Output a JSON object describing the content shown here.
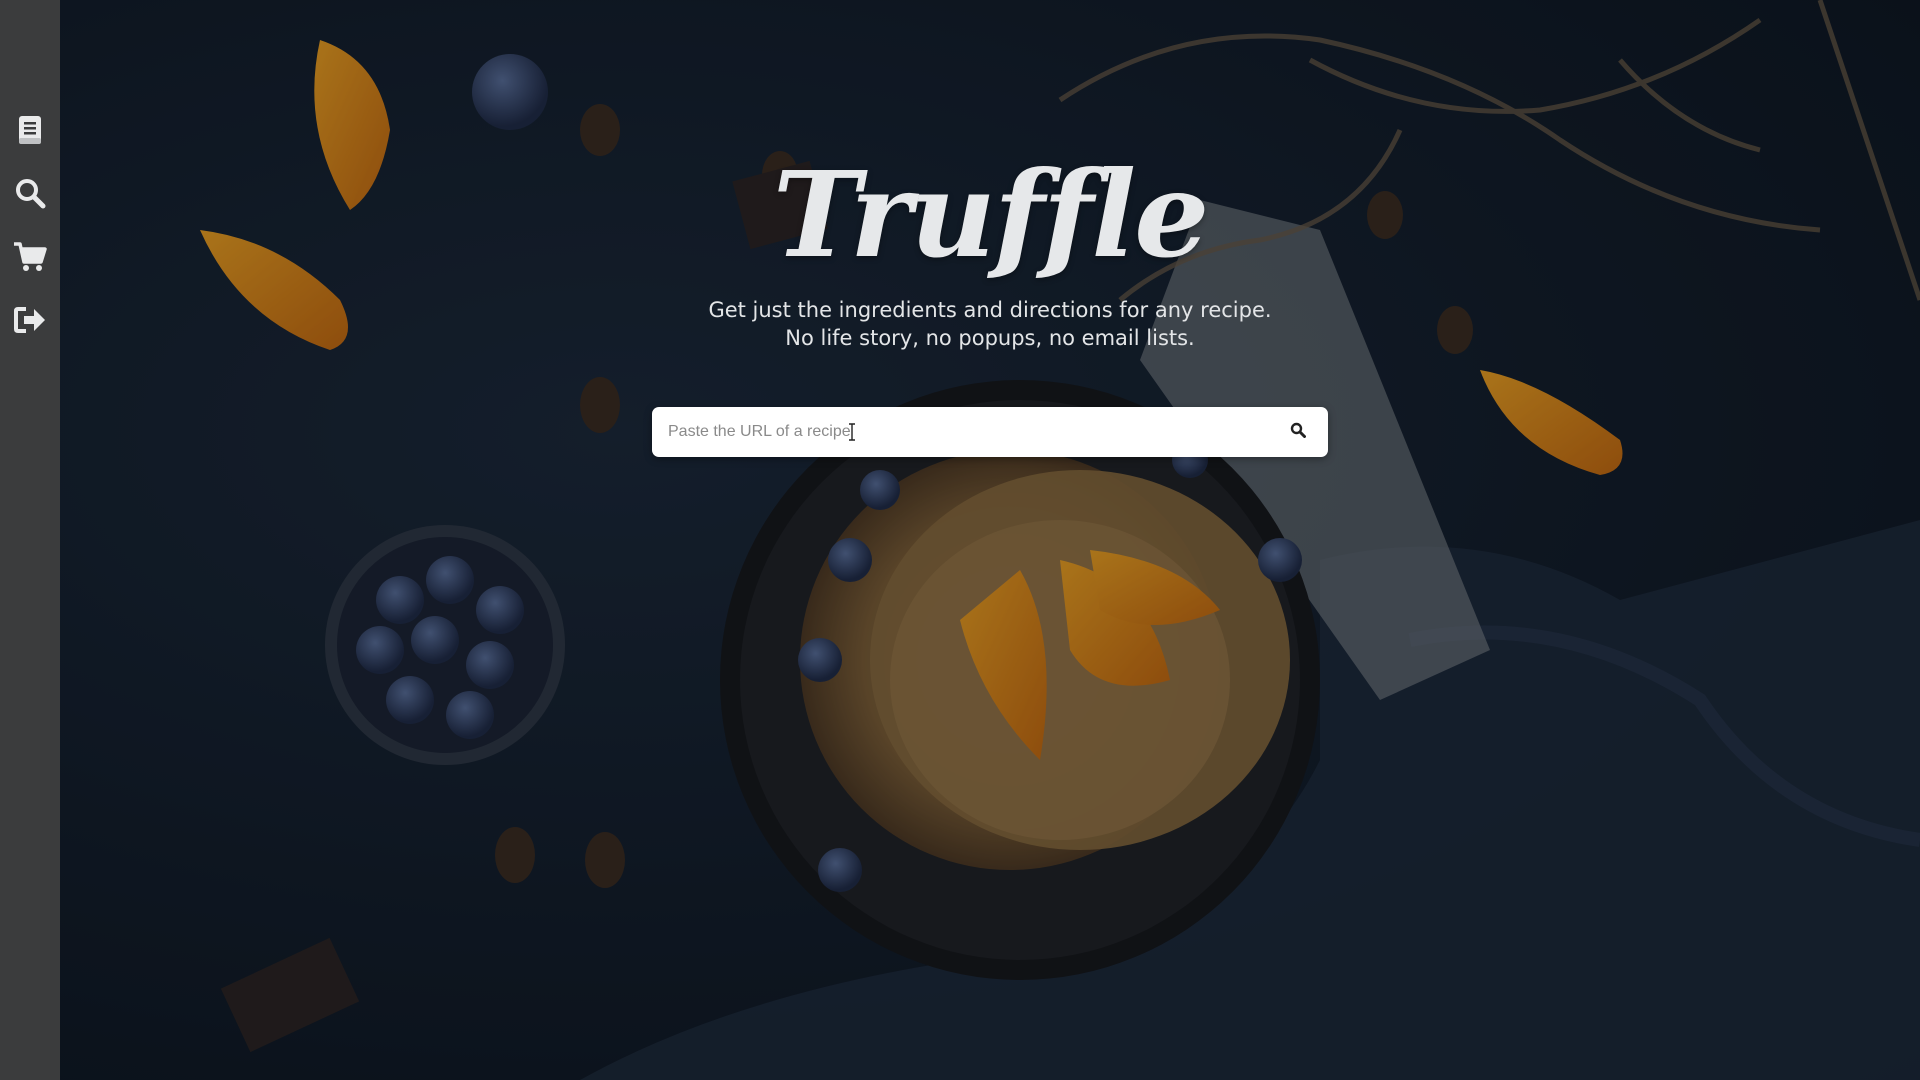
{
  "sidebar": {
    "items": [
      {
        "name": "recipes",
        "icon": "book-icon"
      },
      {
        "name": "search",
        "icon": "search-icon"
      },
      {
        "name": "cart",
        "icon": "shopping-cart-icon"
      },
      {
        "name": "logout",
        "icon": "sign-out-icon"
      }
    ]
  },
  "hero": {
    "logo": "Truffle",
    "tagline": "Get just the ingredients and directions for any recipe. No life story, no popups, no email lists."
  },
  "search": {
    "placeholder": "Paste the URL of a recipe",
    "value": "",
    "button_icon": "search-icon"
  },
  "colors": {
    "sidebar": "#3b3c3d",
    "background": "#111b27",
    "text": "#e6e8ea"
  }
}
